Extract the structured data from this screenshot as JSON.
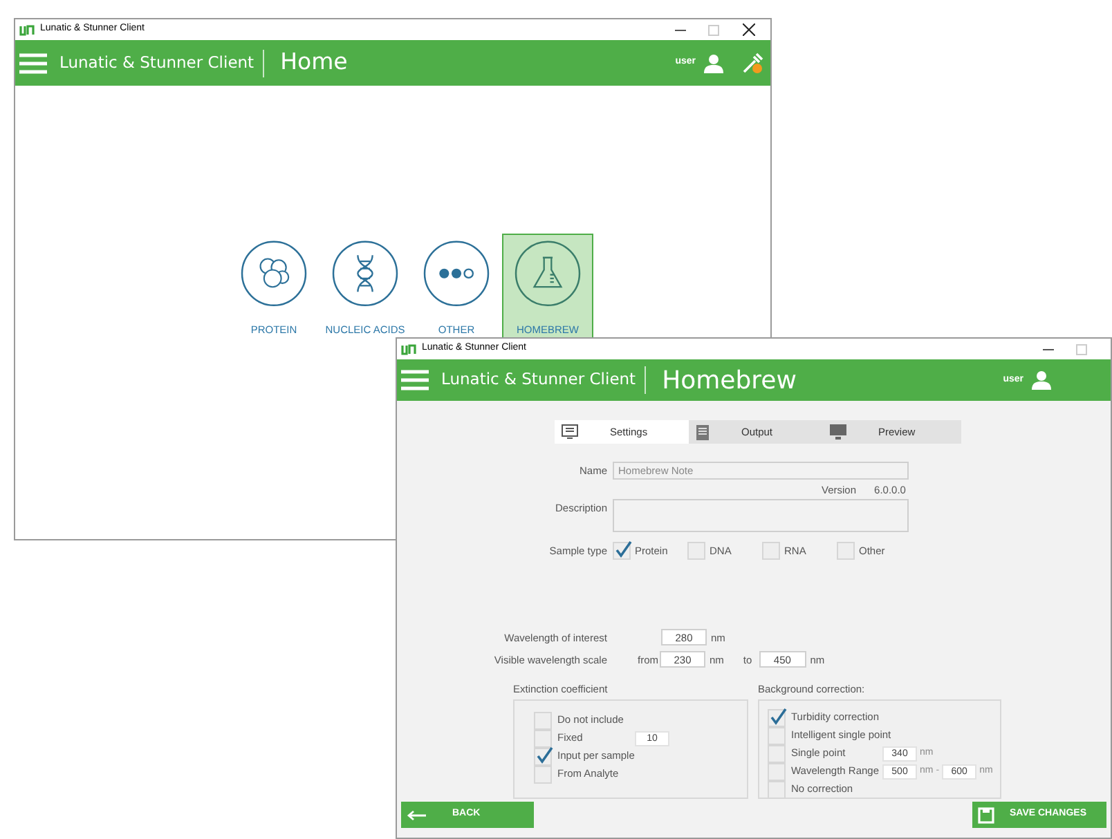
{
  "home_window": {
    "title": "Lunatic & Stunner Client",
    "app_name": "Lunatic & Stunner Client",
    "page_title": "Home",
    "user": "user",
    "categories": [
      {
        "kind": "protein",
        "label": "PROTEIN",
        "selected": false
      },
      {
        "kind": "dna",
        "label": "NUCLEIC ACIDS",
        "selected": false
      },
      {
        "kind": "other",
        "label": "OTHER",
        "selected": false
      },
      {
        "kind": "flask",
        "label": "HOMEBREW",
        "selected": true
      }
    ]
  },
  "homebrew_window": {
    "title": "Lunatic & Stunner Client",
    "app_name": "Lunatic & Stunner Client",
    "page_title": "Homebrew",
    "user": "user",
    "tabs": [
      {
        "kind": "settings",
        "label": "Settings",
        "selected": true
      },
      {
        "kind": "output",
        "label": "Output",
        "selected": false
      },
      {
        "kind": "preview",
        "label": "Preview",
        "selected": false
      }
    ],
    "name": {
      "label": "Name",
      "placeholder": "Homebrew Note"
    },
    "version": {
      "label": "Version",
      "value": "6.0.0.0"
    },
    "description": {
      "label": "Description"
    },
    "sample_type": {
      "label": "Sample type",
      "options": [
        {
          "label": "Protein",
          "checked": true
        },
        {
          "label": "DNA",
          "checked": false
        },
        {
          "label": "RNA",
          "checked": false
        },
        {
          "label": "Other",
          "checked": false
        }
      ]
    },
    "wavelength_of_interest": {
      "label": "Wavelength of interest",
      "value": "280",
      "unit": "nm"
    },
    "visible_wavelength_scale": {
      "label": "Visible wavelength scale",
      "from_label": "from",
      "from_value": "230",
      "from_unit": "nm",
      "to_label": "to",
      "to_value": "450",
      "to_unit": "nm"
    },
    "extinction_coefficient": {
      "title": "Extinction coefficient",
      "options": [
        {
          "kind": "plain",
          "label": "Do not include",
          "checked": false
        },
        {
          "kind": "value",
          "label": "Fixed",
          "checked": false,
          "value": "10"
        },
        {
          "kind": "plain",
          "label": "Input per sample",
          "checked": true
        },
        {
          "kind": "plain",
          "label": "From Analyte",
          "checked": false
        }
      ]
    },
    "background_correction": {
      "title": "Background correction:",
      "options": [
        {
          "kind": "plain",
          "label": "Turbidity correction",
          "checked": true
        },
        {
          "kind": "plain",
          "label": "Intelligent single point",
          "checked": false
        },
        {
          "kind": "value",
          "label": "Single point",
          "checked": false,
          "value": "340",
          "unit": "nm"
        },
        {
          "kind": "range",
          "label": "Wavelength Range",
          "checked": false,
          "value": "500",
          "unit": "nm",
          "separator": "-",
          "value2": "600",
          "unit2": "nm"
        },
        {
          "kind": "plain",
          "label": "No correction",
          "checked": false
        }
      ]
    },
    "back_button": "BACK",
    "save_button": "SAVE CHANGES"
  }
}
